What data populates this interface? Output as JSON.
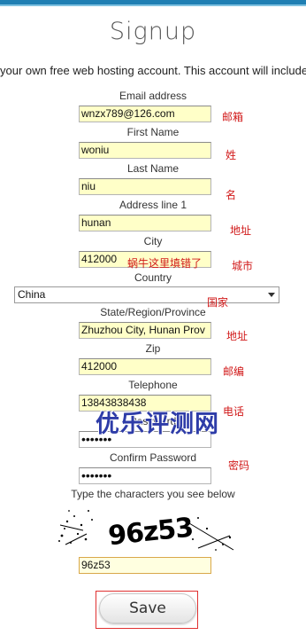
{
  "header": {
    "title": "Signup"
  },
  "intro_text": "your own free web hosting account. This account will include un",
  "fields": {
    "email": {
      "label": "Email address",
      "value": "wnzx789@126.com",
      "note": "邮箱"
    },
    "first": {
      "label": "First Name",
      "value": "woniu",
      "note": "姓"
    },
    "last": {
      "label": "Last Name",
      "value": "niu",
      "note": "名"
    },
    "address": {
      "label": "Address line 1",
      "value": "hunan",
      "note": "地址"
    },
    "city": {
      "label": "City",
      "value": "412000",
      "inline_note": "蜗牛这里填错了",
      "note": "城市"
    },
    "country": {
      "label": "Country",
      "value": "China",
      "note": "国家"
    },
    "state": {
      "label": "State/Region/Province",
      "value": "Zhuzhou City, Hunan Prov",
      "note": "地址"
    },
    "zip": {
      "label": "Zip",
      "value": "412000",
      "note": "邮编"
    },
    "phone": {
      "label": "Telephone",
      "value": "13843838438",
      "note": "电话"
    },
    "password": {
      "label": "Password",
      "value": "•••••••"
    },
    "confirm": {
      "label": "Confirm Password",
      "value": "•••••••",
      "note": "密码"
    },
    "captcha": {
      "label": "Type the characters you see below",
      "image_text": "96z53",
      "value": "96z53"
    }
  },
  "watermark": "优乐评测网",
  "save_button": {
    "label": "Save"
  },
  "colors": {
    "topbar": "#1f7fb3",
    "input_bg": "#ffffc8",
    "note_red": "#d11919",
    "watermark_blue": "#2e3ca8"
  }
}
